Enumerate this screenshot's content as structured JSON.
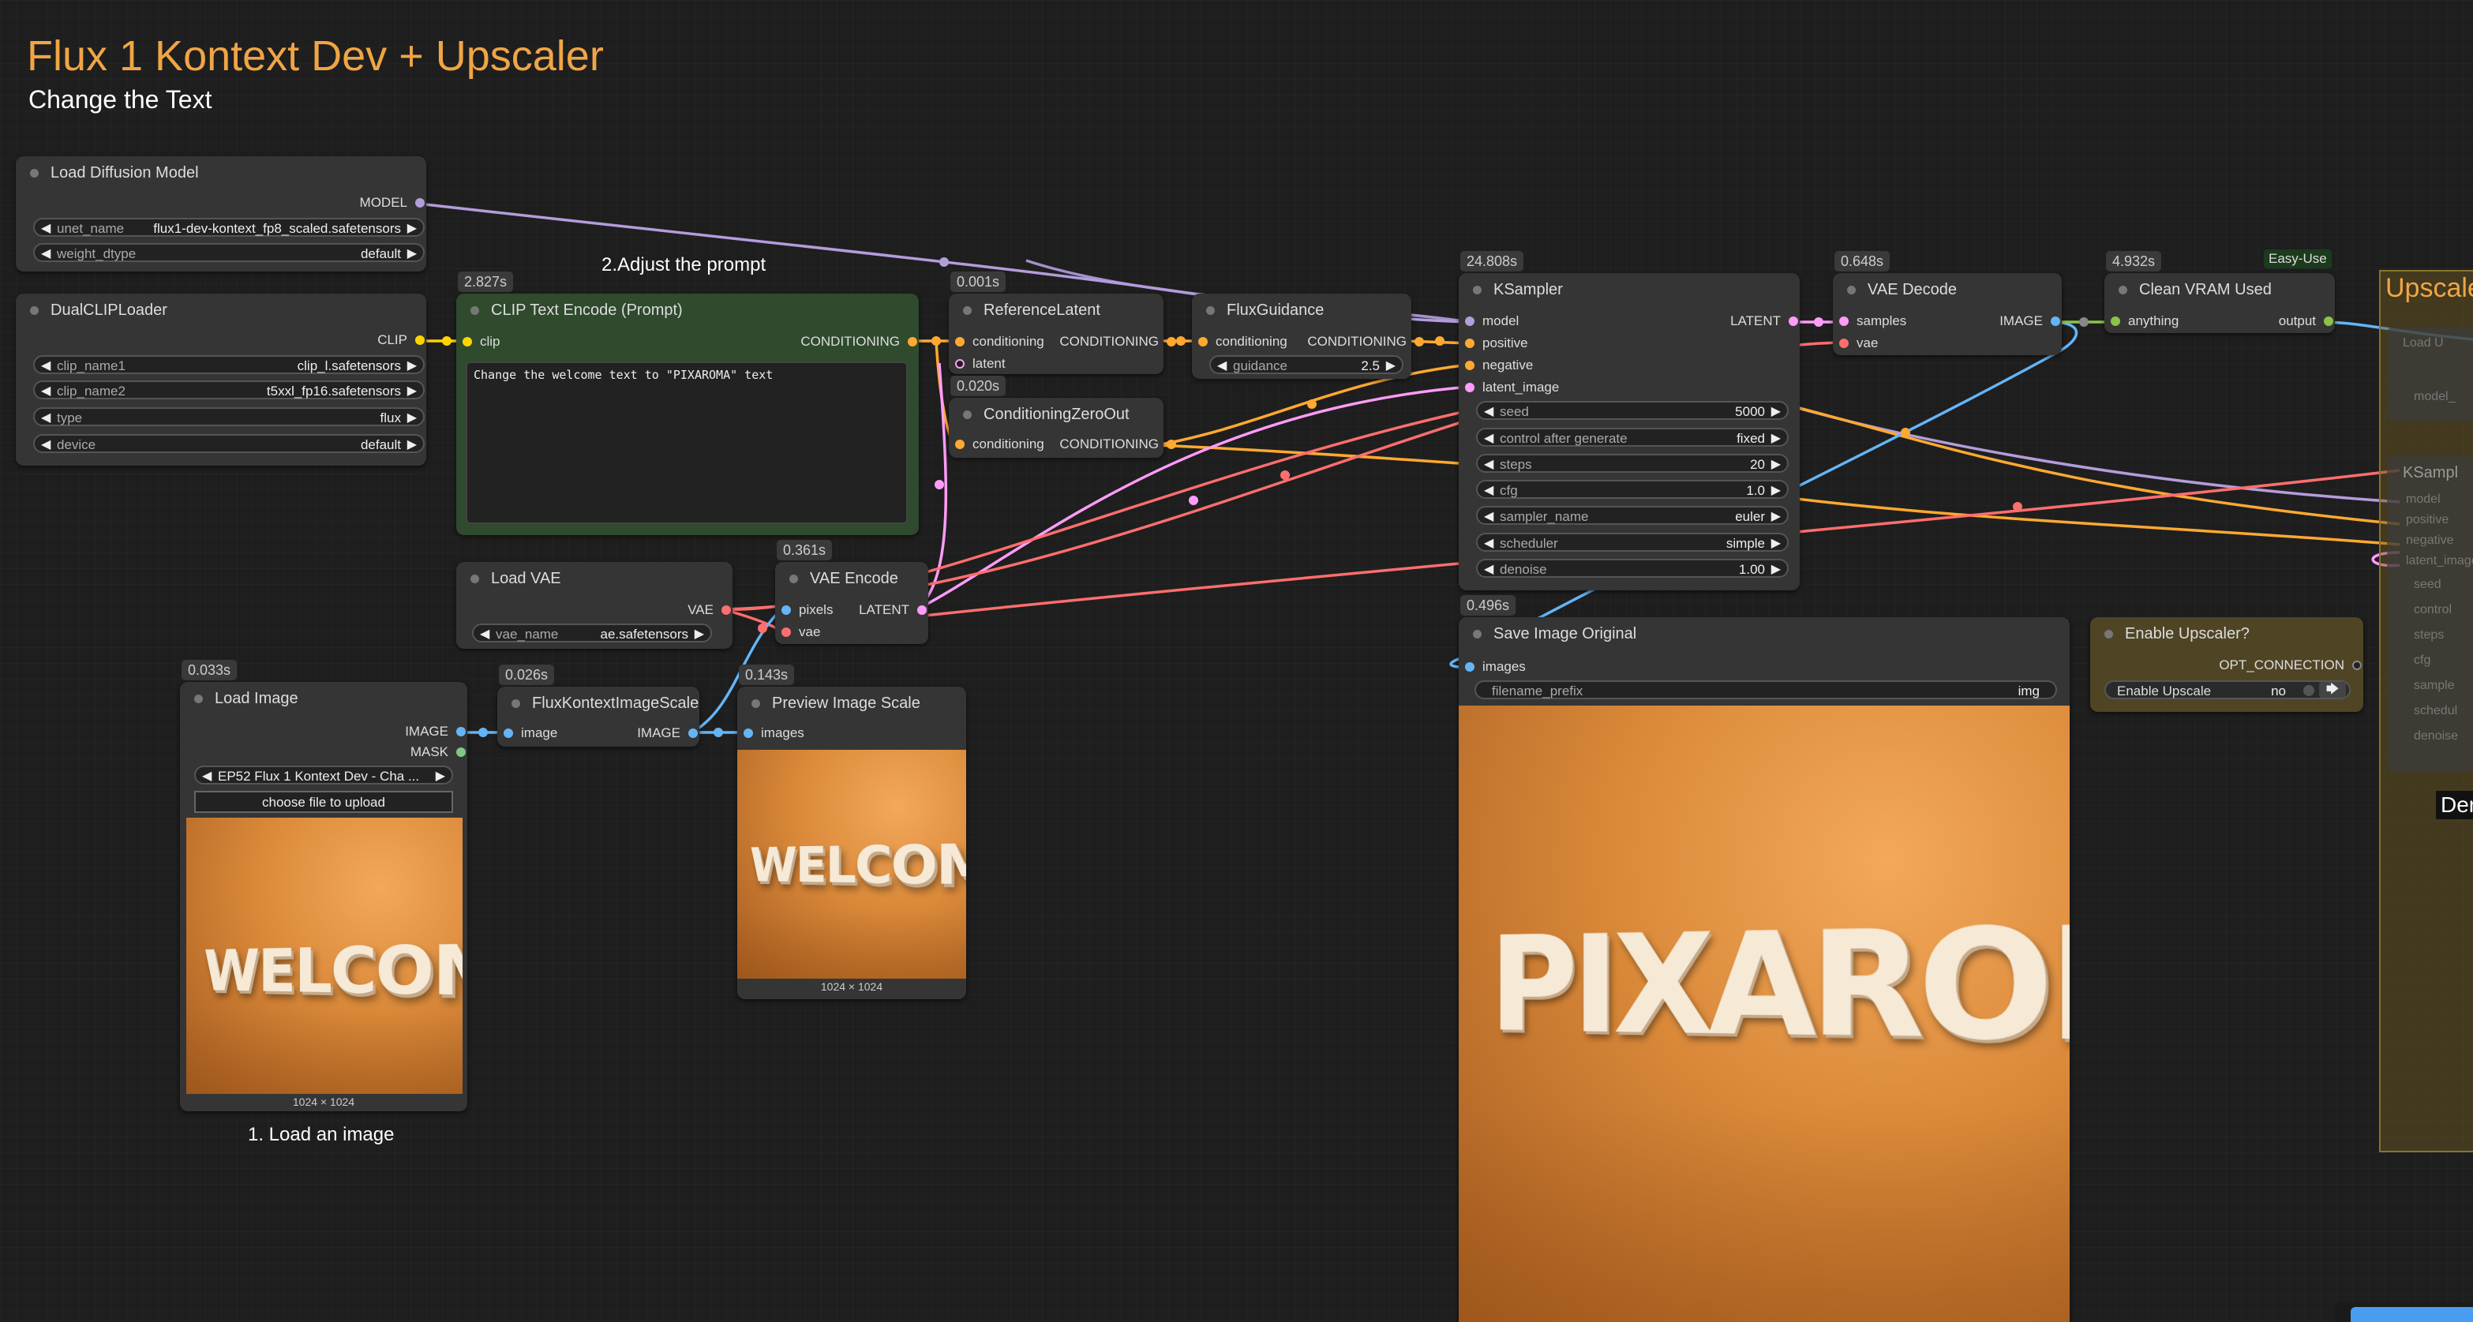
{
  "header": {
    "title": "Flux 1 Kontext Dev + Upscaler",
    "subtitle": "Change the Text"
  },
  "notes": {
    "prompt": "2.Adjust the prompt",
    "load": "1. Load an image"
  },
  "colors": {
    "model": "#b39ddb",
    "clip": "#ffd500",
    "conditioning": "#ffa931",
    "latent": "#ff9cf9",
    "vae": "#ff6e6e",
    "image": "#64b5f6",
    "mask": "#81c784",
    "any": "#8bc34a"
  },
  "nodes": {
    "load_diffusion": {
      "title": "Load Diffusion Model",
      "out_model": "MODEL",
      "unet_label": "unet_name",
      "unet_value": "flux1-dev-kontext_fp8_scaled.safetensors",
      "dtype_label": "weight_dtype",
      "dtype_value": "default"
    },
    "dualclip": {
      "title": "DualCLIPLoader",
      "out_clip": "CLIP",
      "clip1_label": "clip_name1",
      "clip1_value": "clip_l.safetensors",
      "clip2_label": "clip_name2",
      "clip2_value": "t5xxl_fp16.safetensors",
      "type_label": "type",
      "type_value": "flux",
      "device_label": "device",
      "device_value": "default"
    },
    "clip_text": {
      "timing": "2.827s",
      "title": "CLIP Text Encode (Prompt)",
      "in_clip": "clip",
      "out_cond": "CONDITIONING",
      "text": "Change the welcome text to \"PIXAROMA\" text"
    },
    "ref_latent": {
      "timing": "0.001s",
      "title": "ReferenceLatent",
      "in_cond": "conditioning",
      "out_cond": "CONDITIONING",
      "in_latent": "latent"
    },
    "cond_zero": {
      "timing": "0.020s",
      "title": "ConditioningZeroOut",
      "in_cond": "conditioning",
      "out_cond": "CONDITIONING"
    },
    "flux_guidance": {
      "title": "FluxGuidance",
      "in_cond": "conditioning",
      "out_cond": "CONDITIONING",
      "guidance_label": "guidance",
      "guidance_value": "2.5"
    },
    "ksampler": {
      "timing": "24.808s",
      "title": "KSampler",
      "in_model": "model",
      "in_pos": "positive",
      "in_neg": "negative",
      "in_latent": "latent_image",
      "out_latent": "LATENT",
      "widgets": [
        {
          "label": "seed",
          "value": "5000"
        },
        {
          "label": "control after generate",
          "value": "fixed"
        },
        {
          "label": "steps",
          "value": "20"
        },
        {
          "label": "cfg",
          "value": "1.0"
        },
        {
          "label": "sampler_name",
          "value": "euler"
        },
        {
          "label": "scheduler",
          "value": "simple"
        },
        {
          "label": "denoise",
          "value": "1.00"
        }
      ]
    },
    "vae_decode": {
      "timing": "0.648s",
      "title": "VAE Decode",
      "in_samples": "samples",
      "in_vae": "vae",
      "out_image": "IMAGE"
    },
    "clean_vram": {
      "timing": "4.932s",
      "badge": "Easy-Use",
      "title": "Clean VRAM Used",
      "in_any": "anything",
      "out": "output"
    },
    "load_vae": {
      "title": "Load VAE",
      "out_vae": "VAE",
      "name_label": "vae_name",
      "name_value": "ae.safetensors"
    },
    "vae_encode": {
      "timing": "0.361s",
      "title": "VAE Encode",
      "in_pixels": "pixels",
      "in_vae": "vae",
      "out_latent": "LATENT"
    },
    "load_image": {
      "timing": "0.033s",
      "title": "Load Image",
      "out_image": "IMAGE",
      "out_mask": "MASK",
      "image_value": "EP52 Flux 1 Kontext Dev - Cha ...",
      "upload_label": "choose file to upload",
      "preview_word": "WELCOME",
      "dims": "1024 × 1024"
    },
    "flux_scale": {
      "timing": "0.026s",
      "title": "FluxKontextImageScale",
      "in_image": "image",
      "out_image": "IMAGE"
    },
    "preview_scale": {
      "timing": "0.143s",
      "title": "Preview Image Scale",
      "in_images": "images",
      "preview_word": "WELCOME",
      "dims": "1024 × 1024"
    },
    "save_image": {
      "timing": "0.496s",
      "title": "Save Image Original",
      "in_images": "images",
      "prefix_label": "filename_prefix",
      "prefix_value": "img",
      "preview_word": "PIXAROMA"
    },
    "enable_upscaler": {
      "title": "Enable Upscaler?",
      "out": "OPT_CONNECTION",
      "toggle_label": "Enable Upscale",
      "toggle_value": "no"
    }
  },
  "upscale_group": {
    "title": "Upscale",
    "partial_text": "Der",
    "ghost_labels": [
      "Load U",
      "model_",
      "KSampl",
      "model",
      "positive",
      "negative",
      "latent_image",
      "seed",
      "control",
      "steps",
      "cfg",
      "sample",
      "schedul",
      "denoise"
    ]
  }
}
